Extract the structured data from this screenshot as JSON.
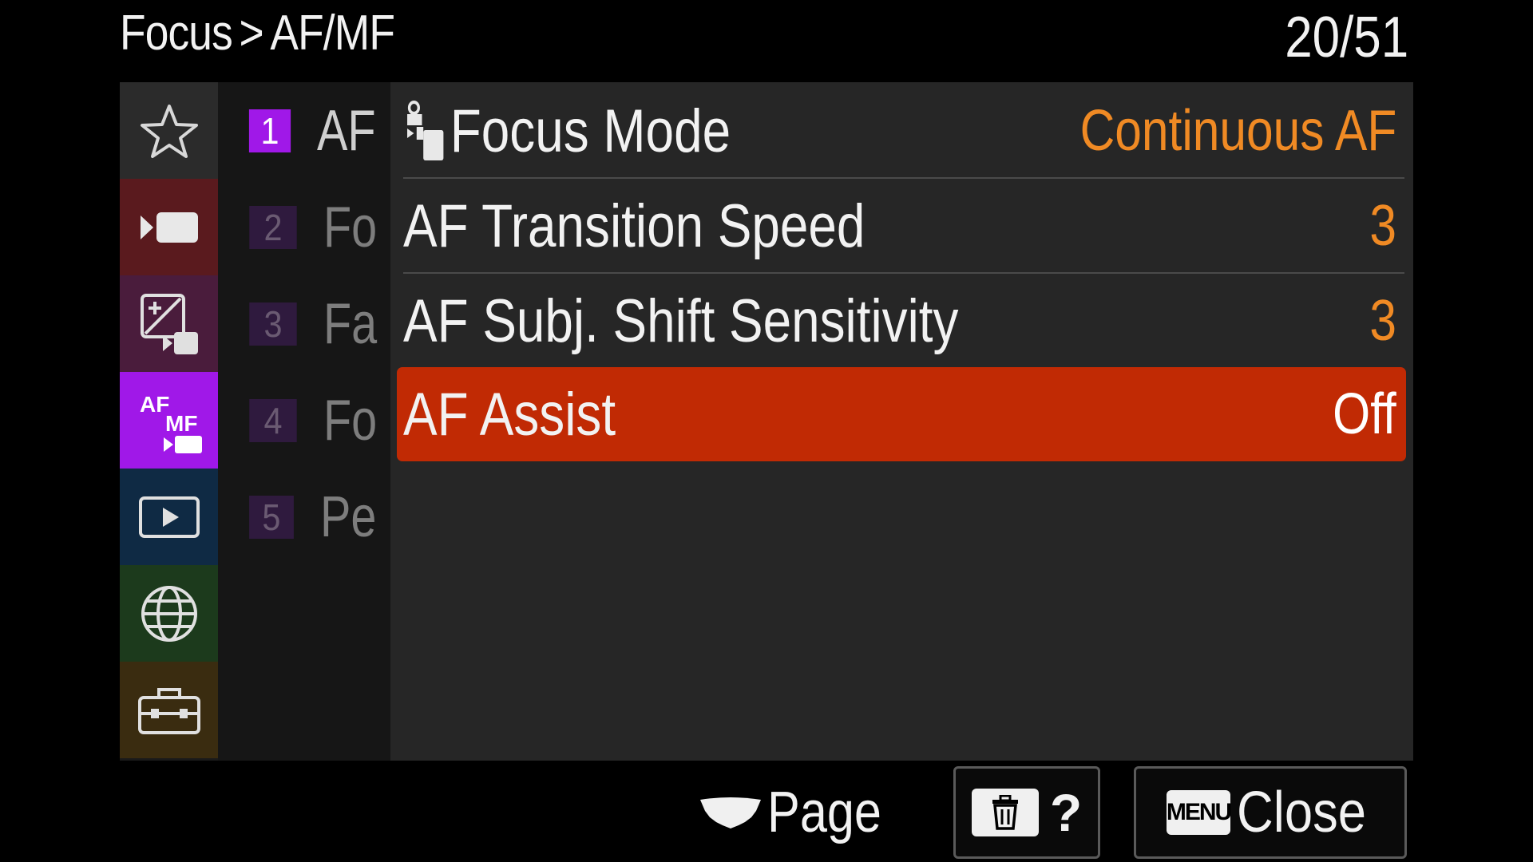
{
  "header": {
    "breadcrumb": [
      "Focus",
      "AF/MF"
    ],
    "separator": ">",
    "page_counter": "20/51"
  },
  "categories": [
    {
      "name": "favorites",
      "icon": "star-icon",
      "color": "#2b2b2b",
      "active": false
    },
    {
      "name": "shooting",
      "icon": "camera-movie-icon",
      "color": "#5a1a1e",
      "active": false
    },
    {
      "name": "exposure-color",
      "icon": "exposure-comp-icon",
      "color": "#4a1c3c",
      "active": false
    },
    {
      "name": "af-mf",
      "icon": "af-mf-icon",
      "color": "#a018e8",
      "active": true
    },
    {
      "name": "playback",
      "icon": "play-icon",
      "color": "#0f2a44",
      "active": false
    },
    {
      "name": "network",
      "icon": "globe-icon",
      "color": "#1c3a1c",
      "active": false
    },
    {
      "name": "setup",
      "icon": "toolbox-icon",
      "color": "#3a2c10",
      "active": false
    }
  ],
  "submenu": [
    {
      "num": "1",
      "label": "AF",
      "active": true
    },
    {
      "num": "2",
      "label": "Fo",
      "active": false
    },
    {
      "num": "3",
      "label": "Fa",
      "active": false
    },
    {
      "num": "4",
      "label": "Fo",
      "active": false
    },
    {
      "num": "5",
      "label": "Pe",
      "active": false
    }
  ],
  "settings": [
    {
      "label": "Focus Mode",
      "value": "Continuous AF",
      "has_icon": true,
      "icon": "photo-movie-icon",
      "selected": false
    },
    {
      "label": "AF Transition Speed",
      "value": "3",
      "has_icon": false,
      "selected": false
    },
    {
      "label": "AF Subj. Shift Sensitivity",
      "value": "3",
      "has_icon": false,
      "selected": false
    },
    {
      "label": "AF Assist",
      "value": "Off",
      "has_icon": false,
      "selected": true
    }
  ],
  "footer": {
    "page_label": "Page",
    "page_icon": "dial-icon",
    "help_label": "?",
    "help_icon": "trash-icon",
    "menu_key": "MENU",
    "close_label": "Close"
  },
  "colors": {
    "value_orange": "#f08a24",
    "selected_row": "#c12a04",
    "active_accent": "#a018e8"
  }
}
